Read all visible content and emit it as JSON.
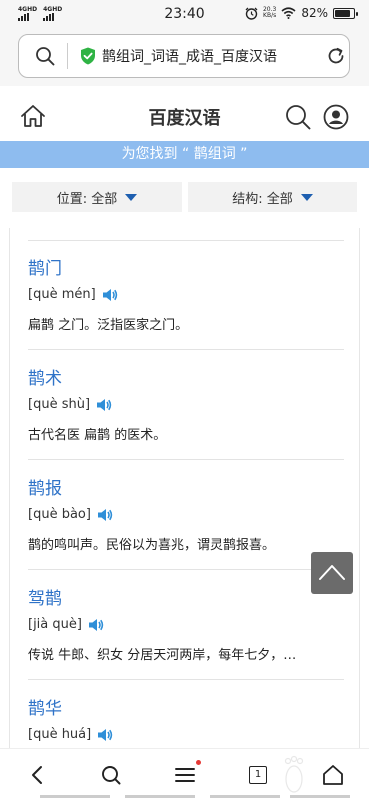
{
  "status": {
    "net1": "4GHD",
    "net2": "4GHD",
    "time": "23:40",
    "speed_val": "20.3",
    "speed_unit": "KB/s",
    "battery": "82%"
  },
  "url": {
    "text": "鹊组词_词语_成语_百度汉语"
  },
  "header": {
    "title": "百度汉语"
  },
  "banner": {
    "text": "为您找到 “ 鹊组词 ”"
  },
  "filters": [
    {
      "label": "位置: 全部"
    },
    {
      "label": "结构: 全部"
    }
  ],
  "entries": [
    {
      "word": "鹊门",
      "pinyin": "[què mén]",
      "definition": "扁鹊 之门。泛指医家之门。"
    },
    {
      "word": "鹊术",
      "pinyin": "[què shù]",
      "definition": "古代名医 扁鹊 的医术。"
    },
    {
      "word": "鹊报",
      "pinyin": "[què bào]",
      "definition": "鹊的鸣叫声。民俗以为喜兆，谓灵鹊报喜。"
    },
    {
      "word": "驾鹊",
      "pinyin": "[jià què]",
      "definition": "传说 牛郎、织女 分居天河两岸，每年七夕，…"
    },
    {
      "word": "鹊华",
      "pinyin": "[què huá]",
      "definition": ""
    }
  ],
  "bottomnav": {
    "tab_count": "1"
  },
  "colors": {
    "accent": "#2f73c8",
    "banner": "#8ebcef",
    "verified": "#2fb344"
  }
}
